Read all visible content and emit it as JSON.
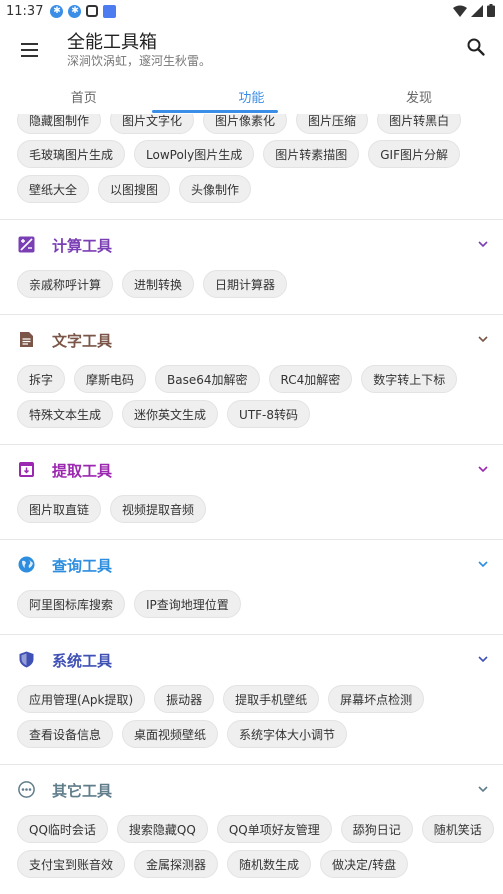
{
  "status_bar": {
    "time": "11:37"
  },
  "app_bar": {
    "title": "全能工具箱",
    "subtitle": "深涧饮涡虹，邃河生秋雷。"
  },
  "tabs": [
    {
      "label": "首页"
    },
    {
      "label": "功能"
    },
    {
      "label": "发现"
    }
  ],
  "image_section": {
    "row0": [
      "隐藏图制作",
      "图片文字化",
      "图片像素化",
      "图片压缩",
      "图片转黑白"
    ],
    "row1": [
      "毛玻璃图片生成",
      "LowPoly图片生成",
      "图片转素描图",
      "GIF图片分解"
    ],
    "row2": [
      "壁纸大全",
      "以图搜图",
      "头像制作"
    ]
  },
  "sections": [
    {
      "title": "计算工具",
      "color": "#7b3fb5",
      "icon": "calculator-icon",
      "rows": [
        [
          "亲戚称呼计算",
          "进制转换",
          "日期计算器"
        ]
      ]
    },
    {
      "title": "文字工具",
      "color": "#7a5548",
      "icon": "document-icon",
      "rows": [
        [
          "拆字",
          "摩斯电码",
          "Base64加解密",
          "RC4加解密",
          "数字转上下标"
        ],
        [
          "特殊文本生成",
          "迷你英文生成",
          "UTF-8转码"
        ]
      ]
    },
    {
      "title": "提取工具",
      "color": "#9c27b0",
      "icon": "archive-icon",
      "rows": [
        [
          "图片取直链",
          "视频提取音频"
        ]
      ]
    },
    {
      "title": "查询工具",
      "color": "#2d8ee0",
      "icon": "globe-icon",
      "rows": [
        [
          "阿里图标库搜索",
          "IP查询地理位置"
        ]
      ]
    },
    {
      "title": "系统工具",
      "color": "#3f51b5",
      "icon": "shield-icon",
      "rows": [
        [
          "应用管理(Apk提取)",
          "振动器",
          "提取手机壁纸",
          "屏幕坏点检测"
        ],
        [
          "查看设备信息",
          "桌面视频壁纸",
          "系统字体大小调节"
        ]
      ]
    },
    {
      "title": "其它工具",
      "color": "#607d8b",
      "icon": "more-horizontal-icon",
      "rows": [
        [
          "QQ临时会话",
          "搜索隐藏QQ",
          "QQ单项好友管理",
          "舔狗日记",
          "随机笑话"
        ],
        [
          "支付宝到账音效",
          "金属探测器",
          "随机数生成",
          "做决定/转盘"
        ]
      ]
    }
  ]
}
